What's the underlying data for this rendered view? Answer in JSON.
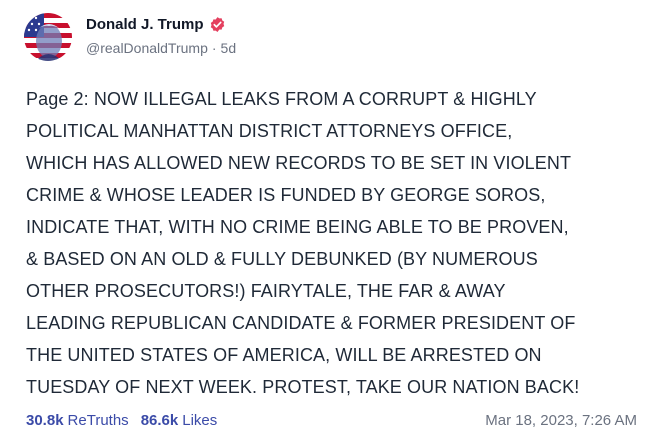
{
  "author": {
    "display_name": "Donald J. Trump",
    "handle": "@realDonaldTrump",
    "age": "5d",
    "verified_icon": "verified-badge-icon",
    "verified_color": "#e4405f"
  },
  "post": {
    "lines": [
      "Page 2: NOW ILLEGAL LEAKS FROM A CORRUPT & HIGHLY",
      "POLITICAL MANHATTAN DISTRICT ATTORNEYS OFFICE,",
      "WHICH HAS ALLOWED NEW RECORDS TO BE SET IN VIOLENT",
      "CRIME & WHOSE LEADER IS FUNDED BY GEORGE SOROS,",
      "INDICATE THAT, WITH NO CRIME BEING ABLE TO BE PROVEN,",
      "& BASED ON AN OLD & FULLY DEBUNKED (BY NUMEROUS",
      "OTHER PROSECUTORS!) FAIRYTALE, THE FAR & AWAY",
      "LEADING REPUBLICAN CANDIDATE & FORMER PRESIDENT OF",
      "THE UNITED STATES OF AMERICA, WILL BE ARRESTED ON",
      "TUESDAY OF NEXT WEEK. PROTEST, TAKE OUR NATION BACK!"
    ]
  },
  "stats": {
    "retruths_count": "30.8k",
    "retruths_label": "ReTruths",
    "likes_count": "86.6k",
    "likes_label": "Likes",
    "accent_color": "#3b4ba8"
  },
  "timestamp": "Mar 18, 2023, 7:26 AM"
}
